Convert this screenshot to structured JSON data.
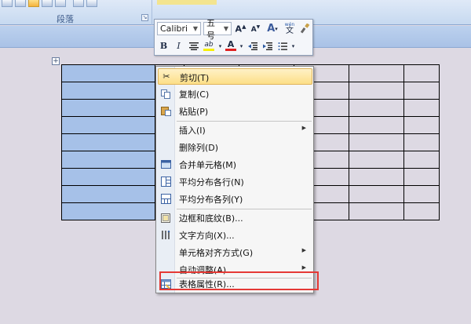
{
  "ribbon": {
    "group_label": "段落"
  },
  "mini_toolbar": {
    "font_name": "Calibri",
    "font_size": "五号",
    "grow_font": "A",
    "shrink_font": "A",
    "format_painter_text": "A",
    "phonetic_top": "wén",
    "phonetic_char": "文",
    "bold": "B",
    "italic": "I",
    "font_color_letter": "A",
    "highlight_letter": "ab",
    "highlight_color": "#f7f000",
    "font_color": "#e02020"
  },
  "context_menu": {
    "items": [
      {
        "label": "剪切(T)",
        "icon": "scissors-icon"
      },
      {
        "label": "复制(C)",
        "icon": "copy-icon"
      },
      {
        "label": "粘贴(P)",
        "icon": "paste-icon"
      },
      {
        "label": "插入(I)",
        "icon": ""
      },
      {
        "label": "删除列(D)",
        "icon": ""
      },
      {
        "label": "合并单元格(M)",
        "icon": "merge-cells-icon"
      },
      {
        "label": "平均分布各行(N)",
        "icon": "distribute-rows-icon"
      },
      {
        "label": "平均分布各列(Y)",
        "icon": "distribute-columns-icon"
      },
      {
        "label": "边框和底纹(B)...",
        "icon": "borders-icon"
      },
      {
        "label": "文字方向(X)...",
        "icon": "text-direction-icon"
      },
      {
        "label": "单元格对齐方式(G)",
        "icon": ""
      },
      {
        "label": "自动调整(A)",
        "icon": ""
      },
      {
        "label": "表格属性(R)...",
        "icon": "table-properties-icon"
      }
    ]
  },
  "colors": {
    "accent_highlight": "#fddf87",
    "selection": "#a6c1e8",
    "callout": "#e53935"
  }
}
